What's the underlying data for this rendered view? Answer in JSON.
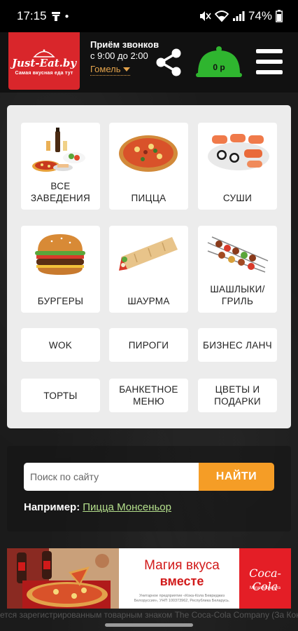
{
  "status_bar": {
    "time": "17:15",
    "battery": "74%"
  },
  "header": {
    "logo_title": "Just-Eat.by",
    "logo_tagline": "Самая вкусная еда тут",
    "call_title": "Приём звонков",
    "call_hours": "с 9:00 до 2:00",
    "city": "Гомель",
    "cart_total": "0 р"
  },
  "categories": [
    {
      "label": "ВСЕ ЗАВЕДЕНИЯ",
      "icon": "food-assortment"
    },
    {
      "label": "ПИЦЦА",
      "icon": "pizza"
    },
    {
      "label": "СУШИ",
      "icon": "sushi"
    },
    {
      "label": "БУРГЕРЫ",
      "icon": "burger"
    },
    {
      "label": "ШАУРМА",
      "icon": "shawarma"
    },
    {
      "label": "ШАШЛЫКИ/ ГРИЛЬ",
      "icon": "skewers"
    },
    {
      "label": "WOK"
    },
    {
      "label": "ПИРОГИ"
    },
    {
      "label": "БИЗНЕС ЛАНЧ"
    },
    {
      "label": "ТОРТЫ"
    },
    {
      "label": "БАНКЕТНОЕ МЕНЮ"
    },
    {
      "label": "ЦВЕТЫ И ПОДАРКИ"
    }
  ],
  "search": {
    "placeholder": "Поиск по сайту",
    "button_label": "НАЙТИ",
    "example_prefix": "Например:",
    "example_link": "Пицца Монсеньор"
  },
  "banner": {
    "title": "Магия вкуса",
    "title2": "вместе",
    "fine_print": "Унитарное предприятие «Кока-Кола Бевриджиз Белоруссия», УНП 100373962, Республика Беларусь.",
    "brand": "Coca-Cola",
    "brand_sub": "Магия Момента"
  },
  "footer_text": "ется зарегистрированным товарным знаком The Coca-Cola Company (За Кока-Кола Кок",
  "colors": {
    "brand_red": "#d9262b",
    "accent_orange": "#f59d26",
    "cart_green": "#2fb52f",
    "link_green": "#b5e08c"
  }
}
